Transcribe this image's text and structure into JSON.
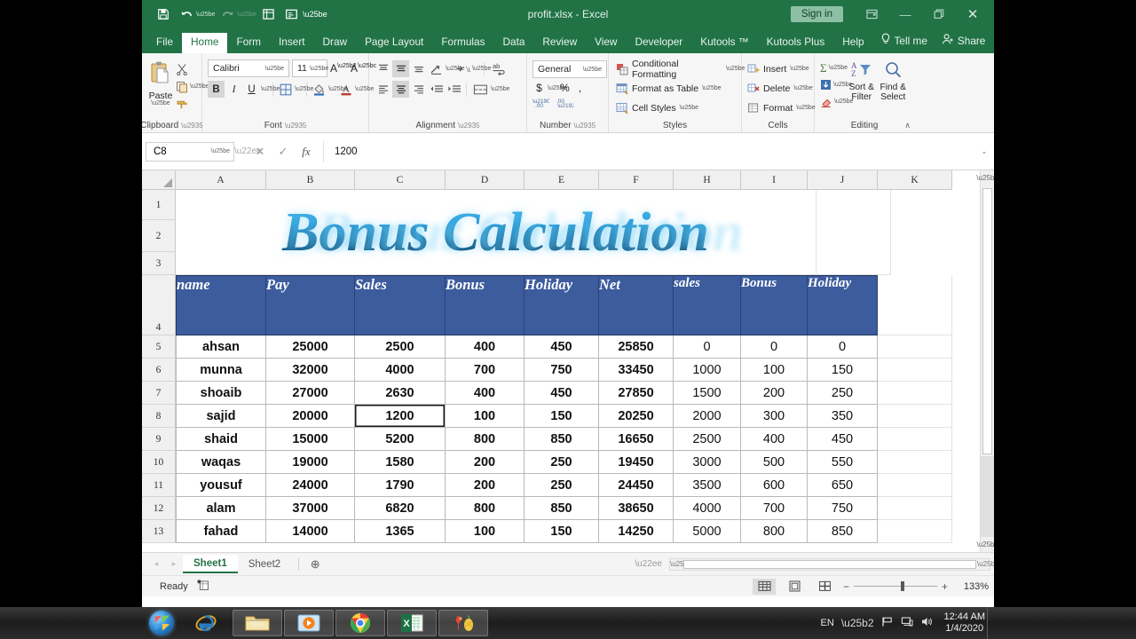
{
  "titlebar": {
    "doc_title": "profit.xlsx  -  Excel",
    "signin_label": "Sign in",
    "qat": [
      {
        "name": "save-icon",
        "glyph": "⬜"
      },
      {
        "name": "undo-icon",
        "glyph": "↶"
      },
      {
        "name": "redo-icon",
        "glyph": "↷"
      },
      {
        "name": "quick-print-icon",
        "glyph": "▤"
      },
      {
        "name": "form-icon",
        "glyph": "▥"
      },
      {
        "name": "customize-qat-icon",
        "glyph": "▾"
      }
    ],
    "ribbon_display_label": "⬒",
    "minimize_label": "—",
    "restore_label": "❐",
    "close_label": "✕"
  },
  "tabs": [
    {
      "label": "File",
      "active": false
    },
    {
      "label": "Home",
      "active": true
    },
    {
      "label": "Form",
      "active": false
    },
    {
      "label": "Insert",
      "active": false
    },
    {
      "label": "Draw",
      "active": false
    },
    {
      "label": "Page Layout",
      "active": false
    },
    {
      "label": "Formulas",
      "active": false
    },
    {
      "label": "Data",
      "active": false
    },
    {
      "label": "Review",
      "active": false
    },
    {
      "label": "View",
      "active": false
    },
    {
      "label": "Developer",
      "active": false
    },
    {
      "label": "Kutools ™",
      "active": false
    },
    {
      "label": "Kutools Plus",
      "active": false
    },
    {
      "label": "Help",
      "active": false
    }
  ],
  "tellme": {
    "label": "Tell me",
    "icon": "lightbulb-icon"
  },
  "share": {
    "label": "Share",
    "icon": "share-person-icon"
  },
  "ribbon": {
    "clipboard": {
      "label": "Clipboard",
      "paste_label": "Paste",
      "cut_label": "✂",
      "copy_label": "⧉",
      "format_painter_label": "🖌"
    },
    "font": {
      "label": "Font",
      "font_name": "Calibri",
      "font_size": "11",
      "grow_label": "A",
      "shrink_label": "A",
      "bold_label": "B",
      "italic_label": "I",
      "underline_label": "U",
      "borders_label": "⊞",
      "fill_label": "⬛",
      "fontcolor_label": "A"
    },
    "alignment": {
      "label": "Alignment",
      "align_top": "≡",
      "align_middle": "≡",
      "align_bottom": "≡",
      "orientation": "⤴",
      "ltr": "¶",
      "align_left": "≡",
      "align_center": "≡",
      "align_right": "≡",
      "decrease_indent": "←",
      "increase_indent": "→",
      "wrap_text": "ab",
      "merge_center": "▤"
    },
    "number": {
      "label": "Number",
      "format": "General",
      "currency": "$",
      "percent": "%",
      "comma": ",",
      "decrease_decimal": ".00",
      "increase_decimal": ".0"
    },
    "styles": {
      "label": "Styles",
      "items": [
        {
          "label": "Conditional Formatting",
          "icon": "conditional-formatting-icon"
        },
        {
          "label": "Format as Table",
          "icon": "format-as-table-icon"
        },
        {
          "label": "Cell Styles",
          "icon": "cell-styles-icon"
        }
      ]
    },
    "cells": {
      "label": "Cells",
      "items": [
        {
          "label": "Insert",
          "icon": "insert-cells-icon"
        },
        {
          "label": "Delete",
          "icon": "delete-cells-icon"
        },
        {
          "label": "Format",
          "icon": "format-cells-icon"
        }
      ]
    },
    "editing": {
      "label": "Editing",
      "autosum": "Σ",
      "fill": "⬇",
      "clear": "▱",
      "sort_filter": "Sort & Filter",
      "find_select": "Find & Select"
    },
    "collapse_label": "∧"
  },
  "formulabar": {
    "namebox_value": "C8",
    "cancel_label": "✕",
    "enter_label": "✓",
    "fx_label": "fx",
    "formula_value": "1200",
    "expand_label": "⌄"
  },
  "grid": {
    "columns": [
      "A",
      "B",
      "C",
      "D",
      "E",
      "F",
      "H",
      "I",
      "J",
      "K"
    ],
    "rows": [
      "1",
      "2",
      "3",
      "4",
      "5",
      "6",
      "7",
      "8",
      "9",
      "10",
      "11",
      "12",
      "13"
    ],
    "sheet_title": "Bonus Calculation",
    "table_headers": [
      "name",
      "Pay",
      "Sales",
      "Bonus",
      "Holiday",
      "Net",
      "sales",
      "Bonus",
      "Holiday"
    ],
    "table_rows": [
      {
        "row": "5",
        "cells": [
          "ahsan",
          "25000",
          "2500",
          "400",
          "450",
          "25850",
          "0",
          "0",
          "0"
        ]
      },
      {
        "row": "6",
        "cells": [
          "munna",
          "32000",
          "4000",
          "700",
          "750",
          "33450",
          "1000",
          "100",
          "150"
        ]
      },
      {
        "row": "7",
        "cells": [
          "shoaib",
          "27000",
          "2630",
          "400",
          "450",
          "27850",
          "1500",
          "200",
          "250"
        ]
      },
      {
        "row": "8",
        "cells": [
          "sajid",
          "20000",
          "1200",
          "100",
          "150",
          "20250",
          "2000",
          "300",
          "350"
        ]
      },
      {
        "row": "9",
        "cells": [
          "shaid",
          "15000",
          "5200",
          "800",
          "850",
          "16650",
          "2500",
          "400",
          "450"
        ]
      },
      {
        "row": "10",
        "cells": [
          "waqas",
          "19000",
          "1580",
          "200",
          "250",
          "19450",
          "3000",
          "500",
          "550"
        ]
      },
      {
        "row": "11",
        "cells": [
          "yousuf",
          "24000",
          "1790",
          "200",
          "250",
          "24450",
          "3500",
          "600",
          "650"
        ]
      },
      {
        "row": "12",
        "cells": [
          "alam",
          "37000",
          "6820",
          "800",
          "850",
          "38650",
          "4000",
          "700",
          "750"
        ]
      },
      {
        "row": "13",
        "cells": [
          "fahad",
          "14000",
          "1365",
          "100",
          "150",
          "14250",
          "5000",
          "800",
          "850"
        ]
      }
    ],
    "selected_cell": "C8",
    "header_fill": "#3c5c9e",
    "title_color": "#1a9fd4"
  },
  "sheettabs": {
    "prev_label": "◂",
    "next_label": "▸",
    "sheets": [
      {
        "label": "Sheet1",
        "active": true
      },
      {
        "label": "Sheet2",
        "active": false
      }
    ],
    "add_label": "⊕"
  },
  "statusbar": {
    "status_text": "Ready",
    "macro_icon": "record-macro-icon",
    "view_normal": "▦",
    "view_pagelayout": "▤",
    "view_pagebreak": "▥",
    "zoom_out": "−",
    "zoom_in": "+",
    "zoom_value": "133%"
  },
  "taskbar": {
    "start_label": "start-orb-icon",
    "items": [
      {
        "name": "internet-explorer-icon",
        "pinned": false
      },
      {
        "name": "file-explorer-icon",
        "pinned": true
      },
      {
        "name": "media-player-icon",
        "pinned": true
      },
      {
        "name": "google-chrome-icon",
        "pinned": true
      },
      {
        "name": "excel-icon",
        "pinned": true
      },
      {
        "name": "fruit-app-icon",
        "pinned": true
      }
    ],
    "language": "EN",
    "tray_icons": [
      "show-hidden-icons",
      "flag-action-center-icon",
      "network-icon",
      "volume-icon"
    ],
    "time": "12:44 AM",
    "date": "1/4/2020"
  }
}
